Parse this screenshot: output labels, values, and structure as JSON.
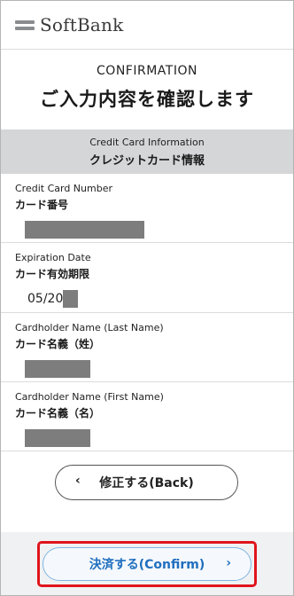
{
  "brand": {
    "name": "SoftBank",
    "icon": "softbank-logo-icon"
  },
  "page": {
    "title_en": "CONFIRMATION",
    "title_jp": "ご入力内容を確認します"
  },
  "section": {
    "title_en": "Credit Card Information",
    "title_jp": "クレジットカード情報"
  },
  "fields": [
    {
      "label_en": "Credit Card Number",
      "label_jp": "カード番号",
      "value": ""
    },
    {
      "label_en": "Expiration Date",
      "label_jp": "カード有効期限",
      "value": "05/20"
    },
    {
      "label_en": "Cardholder Name (Last Name)",
      "label_jp": "カード名義（姓）",
      "value": ""
    },
    {
      "label_en": "Cardholder Name (First Name)",
      "label_jp": "カード名義（名）",
      "value": ""
    }
  ],
  "buttons": {
    "back_label": "修正する(Back)",
    "back_icon": "chevron-left-icon",
    "confirm_label": "決済する(Confirm)",
    "confirm_icon": "chevron-right-icon"
  },
  "colors": {
    "section_bg": "#d4d6d8",
    "confirm_text": "#1f6fbf",
    "highlight_border": "#e0141c",
    "redaction": "#7d7d7d"
  }
}
